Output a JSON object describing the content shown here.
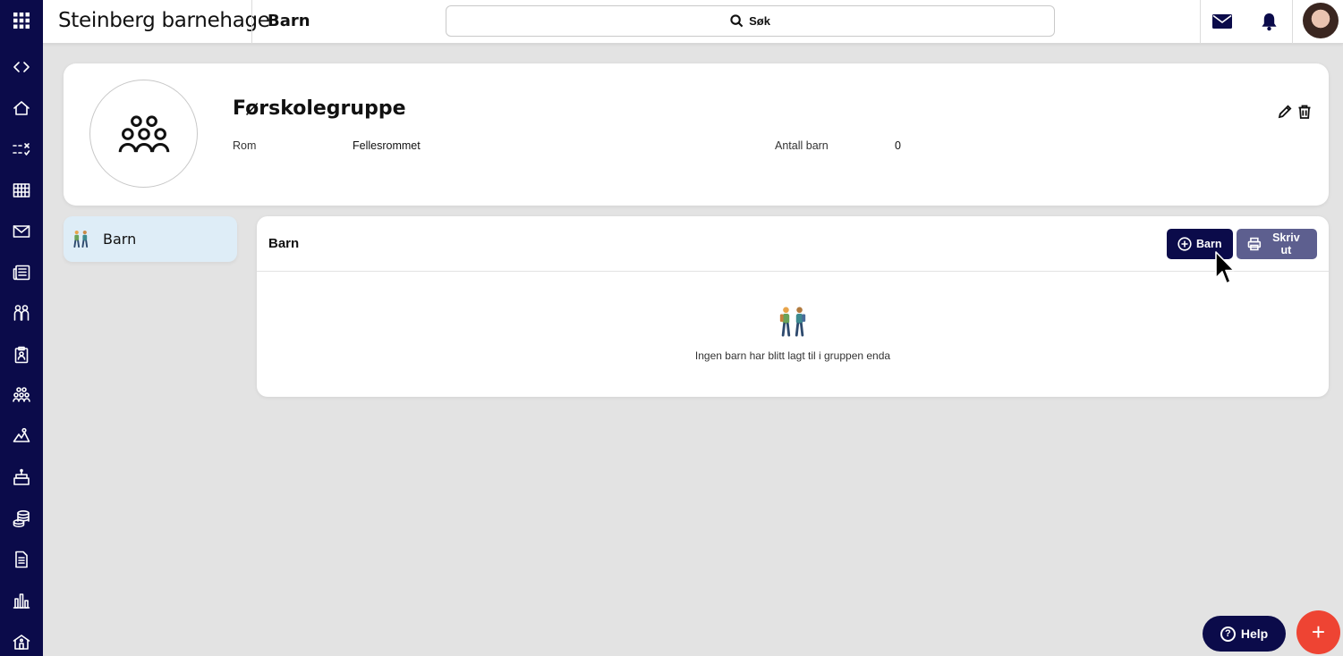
{
  "app": {
    "title": "Steinberg barnehage",
    "page_title": "Barn"
  },
  "search": {
    "label": "Søk",
    "icon": "search-icon"
  },
  "rail": {
    "items": [
      {
        "icon": "apps-grid-icon"
      },
      {
        "icon": "code-toggle-icon"
      },
      {
        "icon": "home-icon"
      },
      {
        "icon": "checklist-icon"
      },
      {
        "icon": "calendar-grid-icon"
      },
      {
        "icon": "mail-icon"
      },
      {
        "icon": "news-icon"
      },
      {
        "icon": "children-icon"
      },
      {
        "icon": "clipboard-icon"
      },
      {
        "icon": "groups-icon"
      },
      {
        "icon": "activities-icon"
      },
      {
        "icon": "birthday-icon"
      },
      {
        "icon": "payments-icon"
      },
      {
        "icon": "document-icon"
      },
      {
        "icon": "statistics-icon"
      },
      {
        "icon": "kindergarten-icon"
      }
    ]
  },
  "topbar_icons": [
    "mail-icon",
    "bell-icon",
    "user-avatar"
  ],
  "group": {
    "name": "Førskolegruppe",
    "room_label": "Rom",
    "room_value": "Fellesrommet",
    "count_label": "Antall barn",
    "count_value": "0"
  },
  "side_nav": {
    "items": [
      {
        "label": "Barn",
        "icon": "children-walking-icon",
        "active": true
      }
    ]
  },
  "panel": {
    "title": "Barn",
    "add_label": "Barn",
    "print_label": "Skriv ut",
    "empty_text": "Ingen barn har blitt lagt til i gruppen enda"
  },
  "help": {
    "label": "Help"
  },
  "fab": {
    "label": "+"
  },
  "colors": {
    "navy": "#0b0b4a",
    "print_button": "#5d5f8f",
    "fab": "#ee4433",
    "side_active": "#deedf7"
  }
}
